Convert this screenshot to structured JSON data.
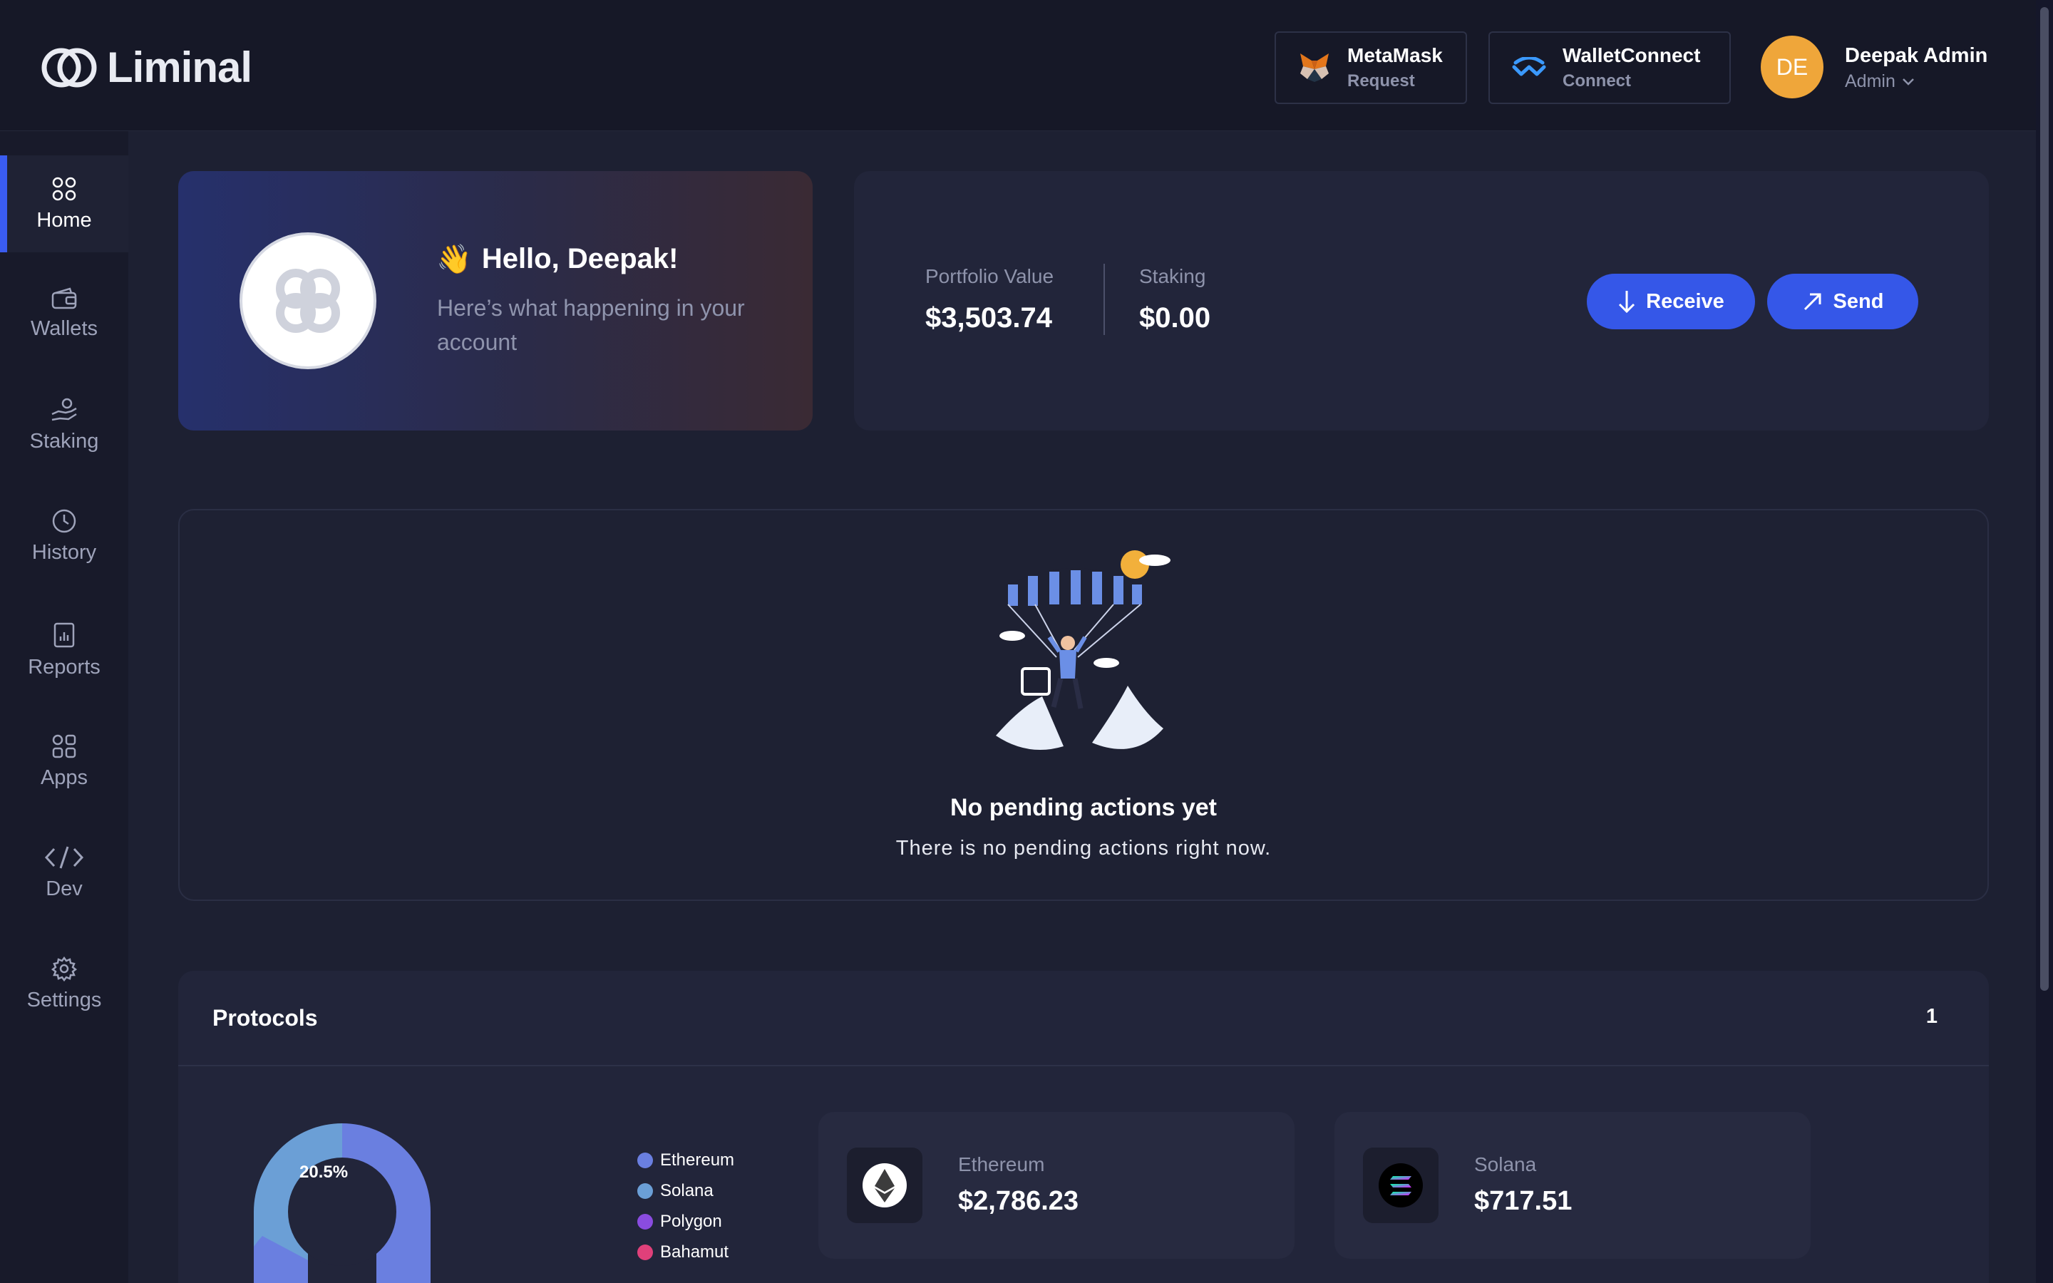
{
  "app": {
    "logo_text": "Liminal"
  },
  "header": {
    "metamask": {
      "title": "MetaMask",
      "subtitle": "Request"
    },
    "walletconnect": {
      "title": "WalletConnect",
      "subtitle": "Connect"
    },
    "user": {
      "initials": "DE",
      "name": "Deepak Admin",
      "role": "Admin"
    }
  },
  "sidebar": {
    "items": [
      {
        "label": "Home",
        "icon": "grid-icon",
        "active": true
      },
      {
        "label": "Wallets",
        "icon": "wallet-icon"
      },
      {
        "label": "Staking",
        "icon": "staking-hand-icon"
      },
      {
        "label": "History",
        "icon": "clock-icon"
      },
      {
        "label": "Reports",
        "icon": "report-icon"
      },
      {
        "label": "Apps",
        "icon": "apps-grid-icon"
      },
      {
        "label": "Dev",
        "icon": "code-icon"
      },
      {
        "label": "Settings",
        "icon": "gear-icon"
      }
    ]
  },
  "greeting": {
    "emoji": "👋",
    "title": "Hello, Deepak!",
    "subtitle": "Here’s what happening in your account"
  },
  "portfolio": {
    "value_label": "Portfolio Value",
    "value": "$3,503.74",
    "staking_label": "Staking",
    "staking_value": "$0.00",
    "receive_label": "Receive",
    "send_label": "Send"
  },
  "pending": {
    "title": "No pending actions yet",
    "subtitle": "There is no pending actions right now."
  },
  "protocols": {
    "title": "Protocols",
    "count": "1",
    "chart_label": "20.5%",
    "legend": [
      {
        "name": "Ethereum",
        "color": "#6a7fe0"
      },
      {
        "name": "Solana",
        "color": "#6b9fd6"
      },
      {
        "name": "Polygon",
        "color": "#8a4ce0"
      },
      {
        "name": "Bahamut",
        "color": "#e0407a"
      }
    ],
    "coins": [
      {
        "name": "Ethereum",
        "value": "$2,786.23",
        "icon": "ethereum-icon"
      },
      {
        "name": "Solana",
        "value": "$717.51",
        "icon": "solana-icon"
      }
    ]
  },
  "colors": {
    "accent": "#3557e8",
    "avatar": "#efa63a",
    "background": "#1d2032"
  }
}
